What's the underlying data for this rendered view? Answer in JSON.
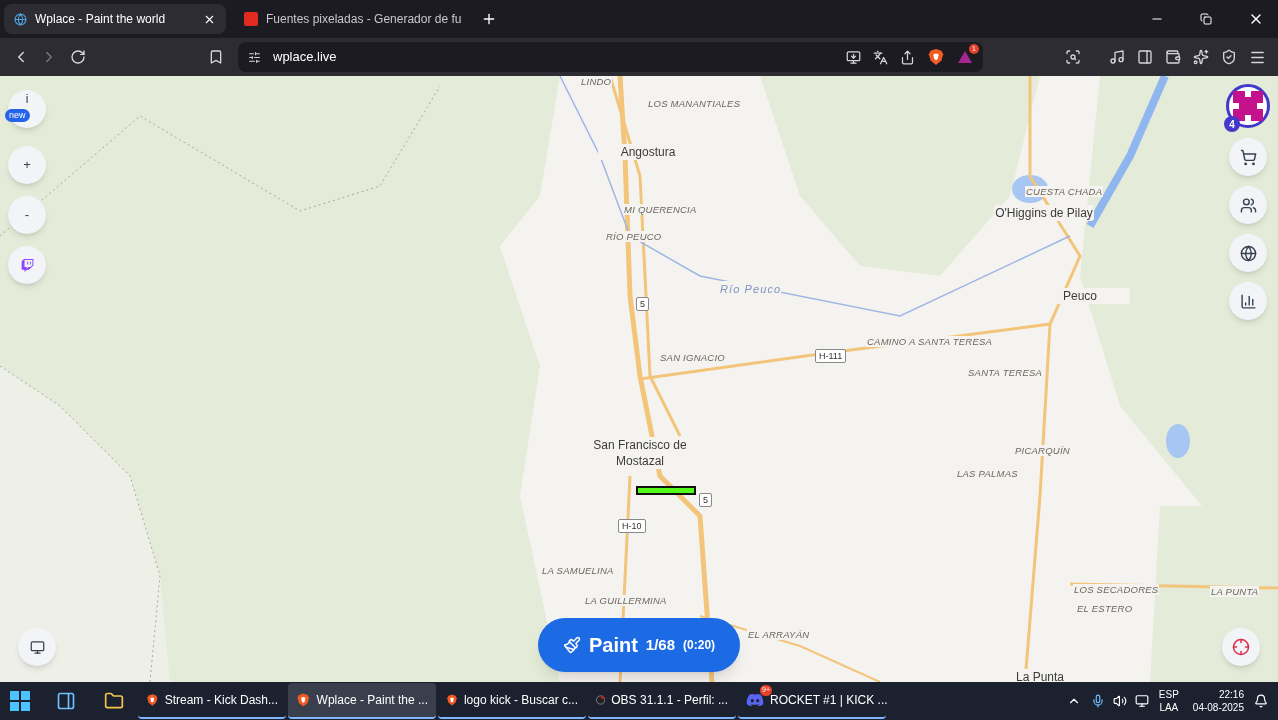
{
  "browser": {
    "tabs": [
      {
        "title": "Wplace - Paint the world",
        "selected": true
      },
      {
        "title": "Fuentes pixeladas - Generador de fu",
        "selected": false
      }
    ],
    "address": "wplace.live",
    "alert_badge": "1"
  },
  "map": {
    "labels": [
      {
        "text": "LINDO",
        "kind": "locality"
      },
      {
        "text": "LOS MANANTIALES",
        "kind": "locality"
      },
      {
        "text": "Angostura",
        "kind": "town"
      },
      {
        "text": "MI QUERENCIA",
        "kind": "locality"
      },
      {
        "text": "RÍO PEUCO",
        "kind": "locality"
      },
      {
        "text": "Río Peuco",
        "kind": "river"
      },
      {
        "text": "5",
        "kind": "shield"
      },
      {
        "text": "SAN IGNACIO",
        "kind": "locality"
      },
      {
        "text": "H-111",
        "kind": "shield"
      },
      {
        "text": "CAMINO A SANTA TERESA",
        "kind": "locality"
      },
      {
        "text": "CUESTA CHADA",
        "kind": "locality"
      },
      {
        "text": "O'Higgins de Pilay",
        "kind": "town"
      },
      {
        "text": "Peuco",
        "kind": "town"
      },
      {
        "text": "SANTA TERESA",
        "kind": "locality"
      },
      {
        "text": "San Francisco de Mostazal",
        "kind": "town"
      },
      {
        "text": "PICARQUÍN",
        "kind": "locality"
      },
      {
        "text": "LAS PALMAS",
        "kind": "locality"
      },
      {
        "text": "5",
        "kind": "shield"
      },
      {
        "text": "H-10",
        "kind": "shield"
      },
      {
        "text": "LA SAMUELINA",
        "kind": "locality"
      },
      {
        "text": "LA GUILLERMINA",
        "kind": "locality"
      },
      {
        "text": "EL ARRAYÁN",
        "kind": "locality"
      },
      {
        "text": "LOS SECADORES",
        "kind": "locality"
      },
      {
        "text": "LA PUNTA",
        "kind": "locality"
      },
      {
        "text": "EL ESTERO",
        "kind": "locality"
      },
      {
        "text": "La Punta",
        "kind": "town"
      }
    ]
  },
  "left_controls": {
    "info": "i",
    "new_badge": "new",
    "zoom_in": "+",
    "zoom_out": "-"
  },
  "profile_badge": "4",
  "paint_button": {
    "label": "Paint",
    "count": "1/68",
    "timer": "(0:20)"
  },
  "taskbar": {
    "items": [
      {
        "title": "Stream - Kick Dash...",
        "kind": "brave",
        "selected": false
      },
      {
        "title": "Wplace - Paint the ...",
        "kind": "brave",
        "selected": true
      },
      {
        "title": "logo kick - Buscar c...",
        "kind": "brave",
        "selected": false
      },
      {
        "title": "OBS 31.1.1 - Perfil: ...",
        "kind": "obs",
        "selected": false
      },
      {
        "title": "ROCKET #1 | KICK ...",
        "kind": "discord",
        "selected": false
      }
    ],
    "discord_badge": "9+",
    "language": "ESP",
    "layout": "LAA",
    "time": "22:16",
    "date": "04-08-2025"
  }
}
